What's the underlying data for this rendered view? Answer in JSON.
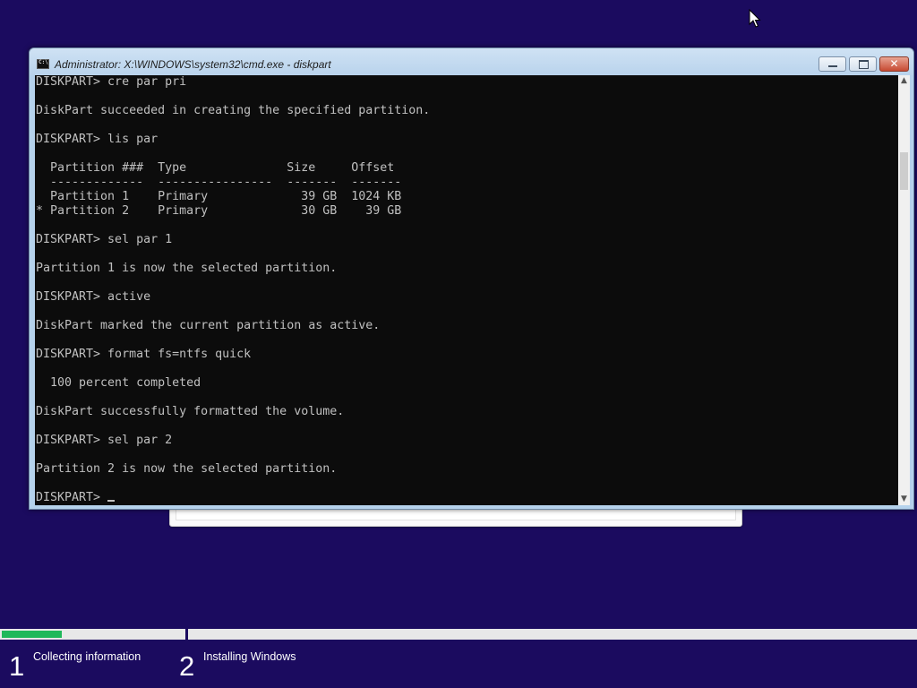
{
  "cmd_window": {
    "title": "Administrator: X:\\WINDOWS\\system32\\cmd.exe - diskpart",
    "minimize_label": "",
    "maximize_label": "",
    "close_label": "✕",
    "console_lines": [
      "DISKPART> cre par pri",
      "",
      "DiskPart succeeded in creating the specified partition.",
      "",
      "DISKPART> lis par",
      "",
      "  Partition ###  Type              Size     Offset",
      "  -------------  ----------------  -------  -------",
      "  Partition 1    Primary             39 GB  1024 KB",
      "* Partition 2    Primary             30 GB    39 GB",
      "",
      "DISKPART> sel par 1",
      "",
      "Partition 1 is now the selected partition.",
      "",
      "DISKPART> active",
      "",
      "DiskPart marked the current partition as active.",
      "",
      "DISKPART> format fs=ntfs quick",
      "",
      "  100 percent completed",
      "",
      "DiskPart successfully formatted the volume.",
      "",
      "DISKPART> sel par 2",
      "",
      "Partition 2 is now the selected partition.",
      ""
    ],
    "prompt": "DISKPART> ",
    "scroll_up_icon": "▲",
    "scroll_down_icon": "▼"
  },
  "setup_progress": {
    "fraction": 0.065,
    "steps": [
      {
        "number": "1",
        "label": "Collecting information"
      },
      {
        "number": "2",
        "label": "Installing Windows"
      }
    ]
  },
  "colors": {
    "desktop_background": "#1b0b5f",
    "progress_fill": "#1fb85a",
    "console_background": "#0c0c0c",
    "console_text": "#c0c0c0"
  }
}
